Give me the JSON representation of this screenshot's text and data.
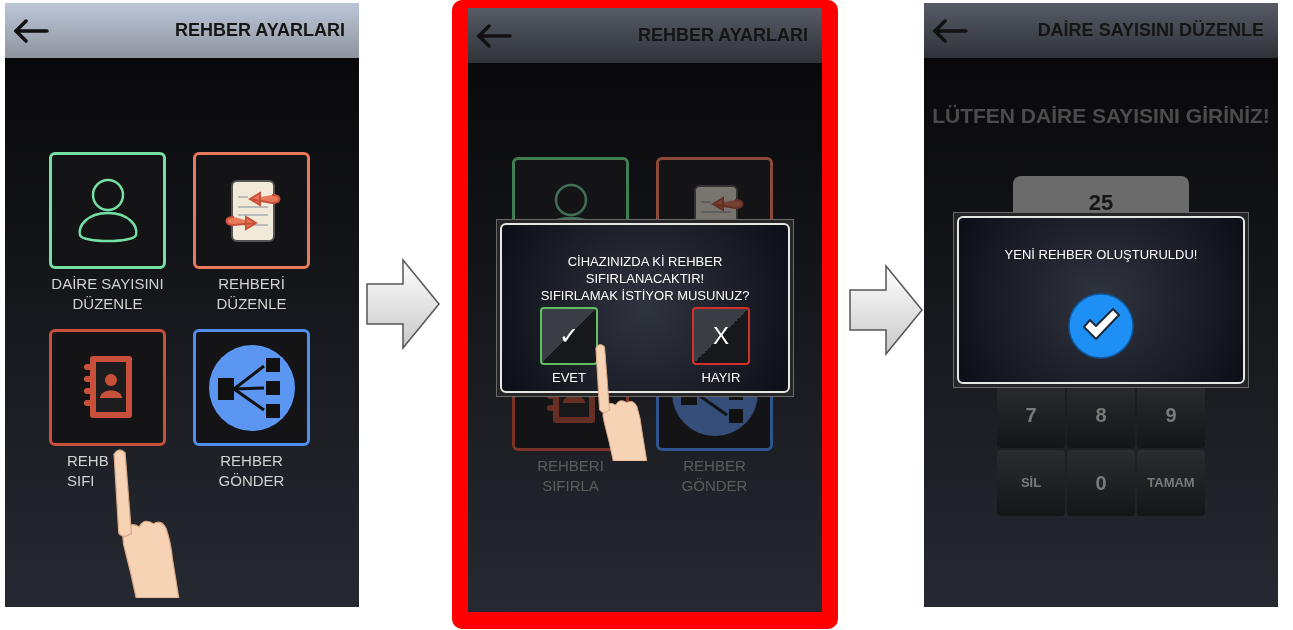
{
  "screens": [
    {
      "kind": "menu",
      "title": "REHBER AYARLARI",
      "tiles": [
        {
          "kind": "person",
          "color": "#74e0a4",
          "label": [
            "DAİRE SAYISINI",
            "DÜZENLE"
          ]
        },
        {
          "kind": "document",
          "color": "#e8795a",
          "label": [
            "REHBERİ",
            "DÜZENLE"
          ]
        },
        {
          "kind": "addressbook",
          "color": "#c9503a",
          "label": [
            "REHB",
            "SIFI"
          ],
          "covered_by_hand": true
        },
        {
          "kind": "share",
          "color": "#4f8ff0",
          "label": [
            "REHBER",
            "GÖNDER"
          ]
        }
      ]
    },
    {
      "kind": "menu",
      "title": "REHBER AYARLARI",
      "highlighted": true,
      "dimmed": true,
      "tiles": [
        {
          "kind": "person",
          "color": "#3f7d52"
        },
        {
          "kind": "document",
          "color": "#8a4a38"
        },
        {
          "kind": "addressbook",
          "color": "#7a3326",
          "label": [
            "REHBERI",
            "SIFIRLA"
          ]
        },
        {
          "kind": "share",
          "color": "#2f5590",
          "label": [
            "REHBER",
            "GÖNDER"
          ]
        }
      ],
      "dialog": {
        "kind": "confirm",
        "message": [
          "CİHAZINIZDA Kİ REHBER",
          "SIFIRLANACAKTIR!",
          "SIFIRLAMAK İSTİYOR MUSUNUZ?"
        ],
        "buttons": [
          {
            "kind": "yes",
            "symbol": "✓",
            "label": "EVET",
            "covered_by_hand": true
          },
          {
            "kind": "no",
            "symbol": "X",
            "label": "HAYIR"
          }
        ]
      }
    },
    {
      "kind": "keypad",
      "title": "DAİRE SAYISINI DÜZENLE",
      "dimmed": true,
      "prompt": "LÜTFEN DAİRE SAYISINI GİRİNİZ!",
      "value": "25",
      "keys": [
        "7",
        "8",
        "9",
        "SİL",
        "0",
        "TAMAM"
      ],
      "dialog": {
        "kind": "notice",
        "message": [
          "YENİ REHBER OLUŞTURULDU!"
        ]
      }
    }
  ]
}
